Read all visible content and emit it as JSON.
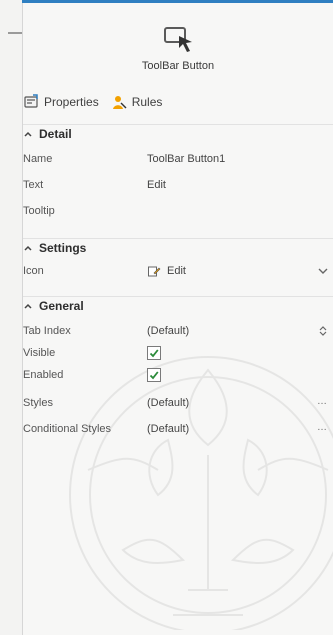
{
  "control": {
    "title": "ToolBar Button"
  },
  "tabs": [
    {
      "label": "Properties"
    },
    {
      "label": "Rules"
    }
  ],
  "sections": {
    "detail": "Detail",
    "settings": "Settings",
    "general": "General"
  },
  "detail": {
    "name": {
      "label": "Name",
      "value": "ToolBar Button1"
    },
    "text": {
      "label": "Text",
      "value": "Edit"
    },
    "tooltip": {
      "label": "Tooltip",
      "value": ""
    }
  },
  "settings": {
    "icon": {
      "label": "Icon",
      "value": "Edit"
    }
  },
  "general": {
    "tab_index": {
      "label": "Tab Index",
      "value": "(Default)"
    },
    "visible": {
      "label": "Visible",
      "checked": true
    },
    "enabled": {
      "label": "Enabled",
      "checked": true
    },
    "styles": {
      "label": "Styles",
      "value": "(Default)"
    },
    "conditional_styles": {
      "label": "Conditional Styles",
      "value": "(Default)"
    }
  },
  "icons": {
    "control": "toolbar-button-icon",
    "properties": "properties-icon",
    "rules": "rules-icon",
    "edit": "edit-icon"
  },
  "colors": {
    "accent": "#2f7fc1",
    "checkmark": "#2b8b3a",
    "rules_icon": "#f2a100"
  }
}
